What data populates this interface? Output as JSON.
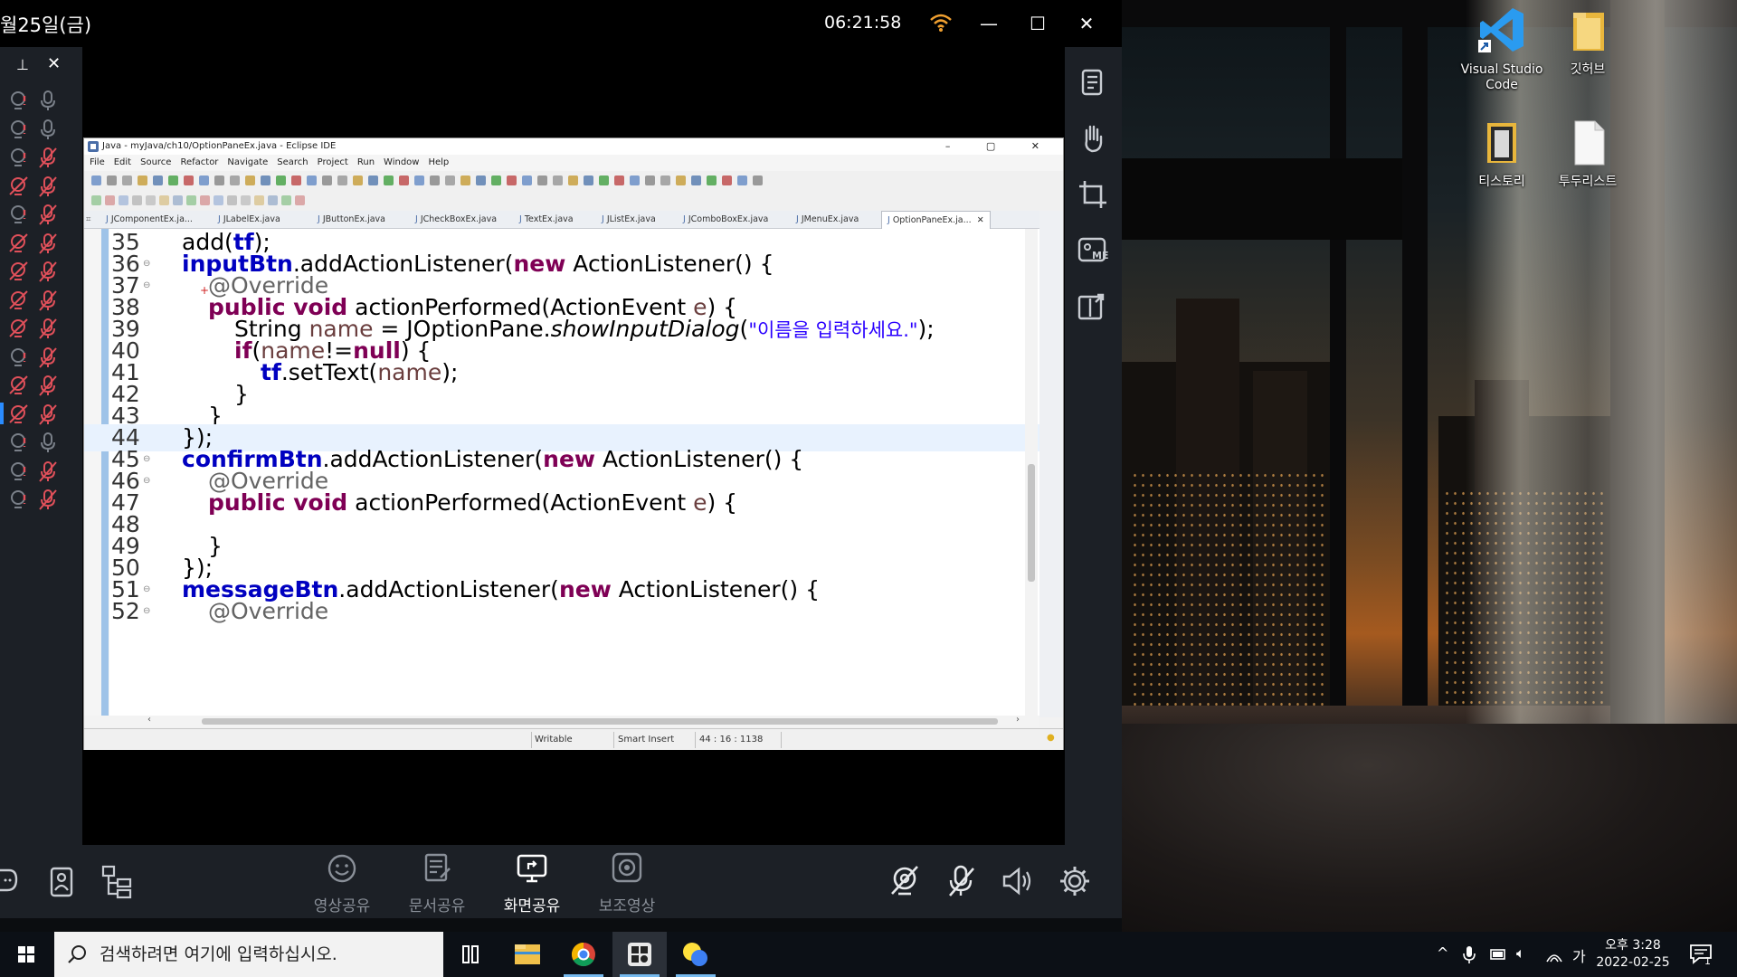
{
  "app": {
    "date_fragment": "월25일(금)",
    "clock": "06:21:58",
    "minimize": "—",
    "maximize": "☐",
    "close": "✕",
    "panel_pin": "⊥",
    "panel_close": "✕",
    "bottom_bar": [
      {
        "label": "영상공유",
        "icon": "smile-icon"
      },
      {
        "label": "문서공유",
        "icon": "document-share-icon"
      },
      {
        "label": "화면공유",
        "icon": "screen-share-icon"
      },
      {
        "label": "보조영상",
        "icon": "secondary-video-icon"
      }
    ]
  },
  "eclipse": {
    "title": "Java - myJava/ch10/OptionPaneEx.java - Eclipse IDE",
    "window_controls": "–  ▢  ✕",
    "menu": [
      "File",
      "Edit",
      "Source",
      "Refactor",
      "Navigate",
      "Search",
      "Project",
      "Run",
      "Window",
      "Help"
    ],
    "tabs": [
      "JComponentEx.ja...",
      "JLabelEx.java",
      "JButtonEx.java",
      "JCheckBoxEx.java",
      "TextEx.java",
      "JListEx.java",
      "JComboBoxEx.java",
      "JMenuEx.java",
      "OptionPaneEx.ja..."
    ],
    "active_tab_close": "✕",
    "code": {
      "l35": "35",
      "l36": "36",
      "l37": "37",
      "l38": "38",
      "l39": "39",
      "l40": "40",
      "l41": "41",
      "l42": "42",
      "l43": "43",
      "l44": "44",
      "l45": "45",
      "l46": "46",
      "l47": "47",
      "l48": "48",
      "l49": "49",
      "l50": "50",
      "l51": "51",
      "l52": "52",
      "add": "add(",
      "tf": "tf",
      "close_semi": ");",
      "inputBtn": "inputBtn",
      "confirmBtn": "confirmBtn",
      "messageBtn": "messageBtn",
      "addListener": ".addActionListener(",
      "new": "new",
      "listener": " ActionListener() {",
      "override": "@Override",
      "public_void": "public void",
      "perform": " actionPerformed(ActionEvent ",
      "e": "e",
      "brace": ") {",
      "string_decl": "String ",
      "name": "name",
      "assign": " = JOptionPane.",
      "showInput": "showInputDialog",
      "paren": "(",
      "prompt": "\"이름을 입력하세요.\"",
      "if": "if",
      "if_cond": "(",
      "notnull": "!=",
      "null": "null",
      "if_end": ") {",
      "tf2": "tf",
      "settext": ".setText(",
      "close_brace": "}",
      "end_listener": "});"
    },
    "status": {
      "writable": "Writable",
      "insert": "Smart Insert",
      "position": "44 : 16 : 1138"
    }
  },
  "desktop": {
    "icons": [
      {
        "label_line1": "Visual Studio",
        "label_line2": "Code"
      },
      {
        "label_line1": "깃허브",
        "label_line2": ""
      },
      {
        "label_line1": "티스토리",
        "label_line2": ""
      },
      {
        "label_line1": "투두리스트",
        "label_line2": ""
      }
    ]
  },
  "taskbar": {
    "search_placeholder": "검색하려면 여기에 입력하십시오.",
    "ime": "가",
    "time": "오후 3:28",
    "date": "2022-02-25",
    "notification_count": "1"
  },
  "colors": {
    "eclipse_keyword": "#7f0055",
    "eclipse_field": "#0000c0",
    "eclipse_string": "#2a00ff",
    "mic_muted": "#e0505a",
    "app_panel": "#1c2026"
  }
}
